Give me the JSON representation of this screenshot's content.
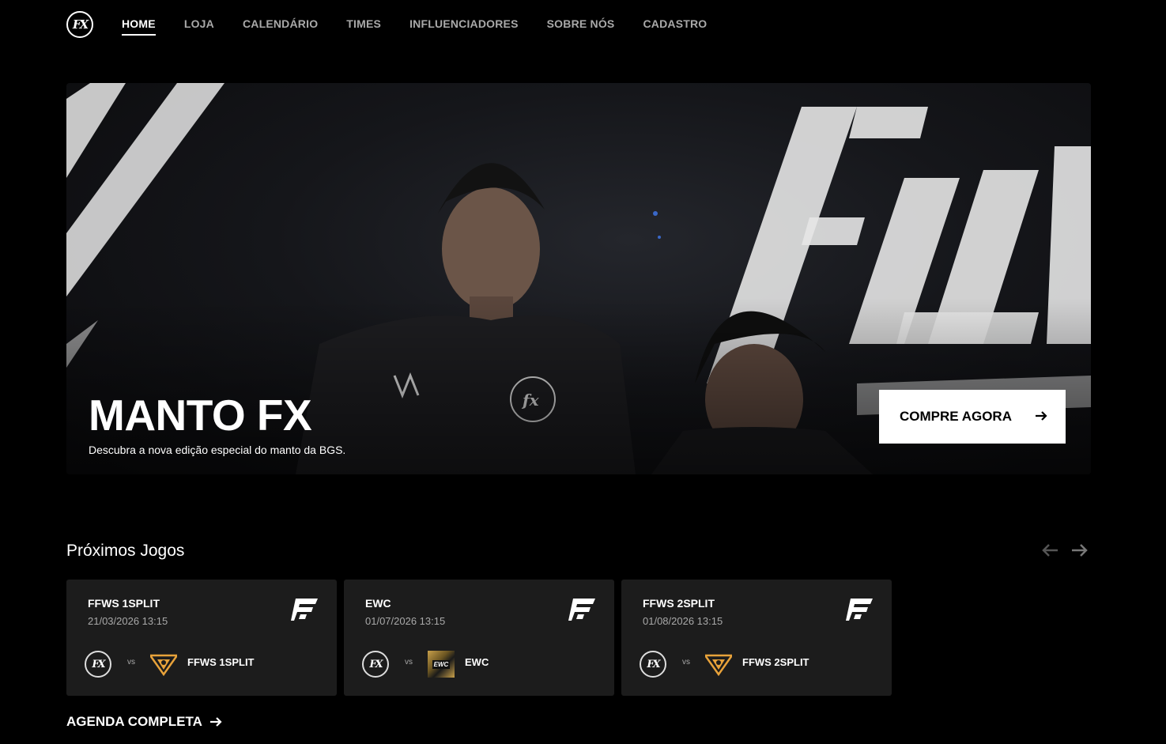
{
  "nav": {
    "logo_text": "FX",
    "links": [
      {
        "label": "HOME",
        "active": true
      },
      {
        "label": "LOJA",
        "active": false
      },
      {
        "label": "CALENDÁRIO",
        "active": false
      },
      {
        "label": "TIMES",
        "active": false
      },
      {
        "label": "INFLUENCIADORES",
        "active": false
      },
      {
        "label": "SOBRE NÓS",
        "active": false
      },
      {
        "label": "CADASTRO",
        "active": false
      }
    ]
  },
  "hero": {
    "title": "MANTO FX",
    "subtitle": "Descubra a nova edição especial do manto da BGS.",
    "cta_label": "COMPRE AGORA",
    "cta_icon": "arrow-right-icon"
  },
  "proximos": {
    "title": "Próximos Jogos",
    "prev_icon": "arrow-left-icon",
    "next_icon": "arrow-right-icon",
    "matches": [
      {
        "title": "FFWS 1SPLIT",
        "date": "21/03/2026 13:15",
        "home_logo": "FX",
        "vs": "vs",
        "opponent": "FFWS 1SPLIT",
        "opponent_logo": "ffws-logo-icon",
        "league_icon": "free-fire-logo-icon"
      },
      {
        "title": "EWC",
        "date": "01/07/2026 13:15",
        "home_logo": "FX",
        "vs": "vs",
        "opponent": "EWC",
        "opponent_logo": "ewc-logo-icon",
        "opponent_logo_text": "EWC",
        "league_icon": "free-fire-logo-icon"
      },
      {
        "title": "FFWS 2SPLIT",
        "date": "01/08/2026 13:15",
        "home_logo": "FX",
        "vs": "vs",
        "opponent": "FFWS 2SPLIT",
        "opponent_logo": "ffws-logo-icon",
        "league_icon": "free-fire-logo-icon"
      }
    ]
  },
  "agenda": {
    "label": "AGENDA COMPLETA",
    "icon": "arrow-right-icon"
  },
  "colors": {
    "background": "#000000",
    "card": "#1c1c1c",
    "muted": "#a9a9a9",
    "ffws_orange": "#e8a23a"
  }
}
